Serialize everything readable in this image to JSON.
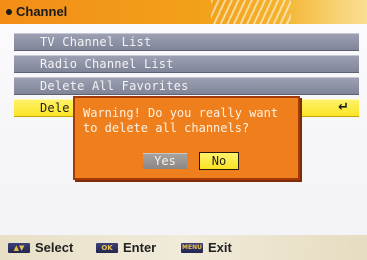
{
  "header": {
    "title": "Channel"
  },
  "menu": {
    "items": [
      {
        "label": "TV Channel List"
      },
      {
        "label": "Radio Channel List"
      },
      {
        "label": "Delete All Favorites"
      },
      {
        "label": "Dele",
        "selected": true,
        "enter_icon": "↵"
      }
    ]
  },
  "dialog": {
    "message": "Warning! Do you really want\nto delete all channels?",
    "yes_label": "Yes",
    "no_label": "No",
    "focused": "No"
  },
  "footer": {
    "hints": [
      {
        "key_text": "▲▼",
        "label": "Select"
      },
      {
        "key_text": "OK",
        "label": "Enter"
      },
      {
        "key_text": "MENU",
        "label": "Exit"
      }
    ]
  },
  "colors": {
    "header_orange": "#f38d17",
    "row_gray": "#8c90a4",
    "selected_yellow": "#fbe323",
    "dialog_orange": "#ef7f1c",
    "footer_beige": "#ece5cf"
  }
}
